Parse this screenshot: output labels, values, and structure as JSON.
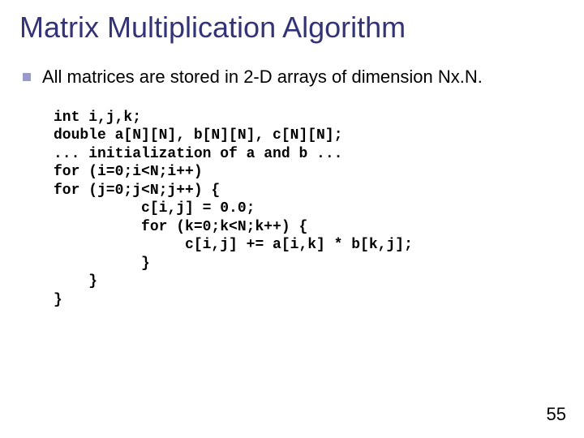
{
  "title": "Matrix Multiplication Algorithm",
  "bullet": "All matrices are stored in 2-D arrays of dimension Nx.N.",
  "code": "int i,j,k;\ndouble a[N][N], b[N][N], c[N][N];\n... initialization of a and b ...\nfor (i=0;i<N;i++)\nfor (j=0;j<N;j++) {\n          c[i,j] = 0.0;\n          for (k=0;k<N;k++) {\n               c[i,j] += a[i,k] * b[k,j];\n          }\n    }\n}",
  "page_number": "55"
}
